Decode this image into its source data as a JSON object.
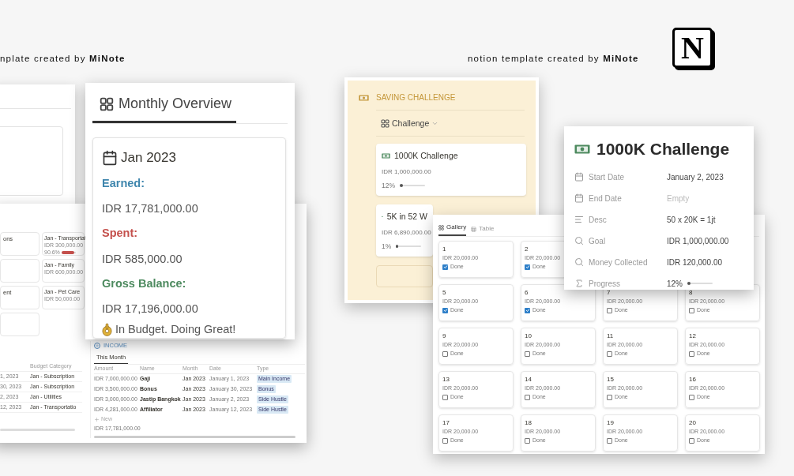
{
  "captions": [
    {
      "text": "nplate created by **MiNote**"
    },
    {
      "text": "notion template created by **MiNote**"
    }
  ],
  "logo": {
    "letter": "N"
  },
  "budget_cards": {
    "left": [
      {
        "kind": "titled",
        "title": "ons"
      },
      {
        "kind": "blank"
      },
      {
        "kind": "titled",
        "title": "ent"
      },
      {
        "kind": "blank"
      }
    ],
    "right": [
      {
        "title": "Jan - Transportat",
        "amount": "IDR 300,000.00",
        "percent": "90.6%",
        "level": 0.9
      },
      {
        "title": "Jan - Family",
        "amount": "IDR 600,000.00"
      },
      {
        "title": "Jan - Pet Care",
        "amount": "IDR 50,000.00"
      }
    ]
  },
  "expense_table": {
    "column": "Budget Category",
    "rows": [
      {
        "date": "1, 2023",
        "category": "Jan - Subscription"
      },
      {
        "date": "30, 2023",
        "category": "Jan - Subscription"
      },
      {
        "date": "2, 2023",
        "category": "Jan - Utilities"
      },
      {
        "date": "12, 2023",
        "category": "Jan - Transportatio"
      }
    ]
  },
  "income": {
    "title": "INCOME",
    "tab": "This Month",
    "columns": [
      "Amount",
      "Name",
      "Month",
      "Date",
      "Type"
    ],
    "rows": [
      {
        "amount": "IDR 7,000,000.00",
        "name": "Gaji",
        "month": "Jan 2023",
        "date": "January 1, 2023",
        "type": "Main Income"
      },
      {
        "amount": "IDR 3,500,000.00",
        "name": "Bonus",
        "month": "Jan 2023",
        "date": "January 30, 2023",
        "type": "Bonus"
      },
      {
        "amount": "IDR 3,000,000.00",
        "name": "Jastip Bangkok",
        "month": "Jan 2023",
        "date": "January 2, 2023",
        "type": "Side Hustle"
      },
      {
        "amount": "IDR 4,281,000.00",
        "name": "Affiliator",
        "month": "Jan 2023",
        "date": "January 12, 2023",
        "type": "Side Hustle"
      }
    ],
    "new": "New",
    "total": "IDR 17,781,000.00"
  },
  "monthly": {
    "title": "Monthly Overview",
    "month": "Jan 2023",
    "lines": [
      {
        "label": "Earned:",
        "value": "IDR 17,781,000.00",
        "color": "#3f86ad"
      },
      {
        "label": "Spent:",
        "value": "IDR 585,000.00",
        "color": "#c4504c"
      },
      {
        "label": "Gross Balance:",
        "value": "IDR 17,196,000.00",
        "color": "#4d8a5f"
      }
    ],
    "status": "In Budget. Doing Great!"
  },
  "saving": {
    "title": "SAVING CHALLENGE",
    "view": "Challenge",
    "cards": [
      {
        "title": "1000K Challenge",
        "amount": "IDR 1,000,000.00",
        "percent": "12%",
        "level": 0.12
      },
      {
        "title": "5K in 52 W",
        "amount": "IDR 6,890,000.00",
        "percent": "1%",
        "level": 0.01
      }
    ]
  },
  "gallery": {
    "tabs": [
      {
        "label": "Gallery",
        "selected": true
      },
      {
        "label": "Table",
        "selected": false
      }
    ],
    "rows": [
      [
        {
          "number": "1",
          "amount": "IDR 20,000.00",
          "label": "Done",
          "checked": true
        },
        {
          "number": "2",
          "amount": "IDR 20,000.00",
          "label": "Done",
          "checked": true
        }
      ],
      [
        {
          "number": "5",
          "amount": "IDR 20,000.00",
          "label": "Done",
          "checked": true
        },
        {
          "number": "6",
          "amount": "IDR 20,000.00",
          "label": "Done",
          "checked": true
        },
        {
          "number": "7",
          "amount": "IDR 20,000.00",
          "label": "Done",
          "checked": false
        },
        {
          "number": "8",
          "amount": "IDR 20,000.00",
          "label": "Done",
          "checked": false
        }
      ],
      [
        {
          "number": "9",
          "amount": "IDR 20,000.00",
          "label": "Done",
          "checked": false
        },
        {
          "number": "10",
          "amount": "IDR 20,000.00",
          "label": "Done",
          "checked": false
        },
        {
          "number": "11",
          "amount": "IDR 20,000.00",
          "label": "Done",
          "checked": false
        },
        {
          "number": "12",
          "amount": "IDR 20,000.00",
          "label": "Done",
          "checked": false
        }
      ],
      [
        {
          "number": "13",
          "amount": "IDR 20,000.00",
          "label": "Done",
          "checked": false
        },
        {
          "number": "14",
          "amount": "IDR 20,000.00",
          "label": "Done",
          "checked": false
        },
        {
          "number": "15",
          "amount": "IDR 20,000.00",
          "label": "Done",
          "checked": false
        },
        {
          "number": "16",
          "amount": "IDR 20,000.00",
          "label": "Done",
          "checked": false
        }
      ],
      [
        {
          "number": "17",
          "amount": "IDR 20,000.00",
          "label": "Done",
          "checked": false
        },
        {
          "number": "18",
          "amount": "IDR 20,000.00",
          "label": "Done",
          "checked": false
        },
        {
          "number": "19",
          "amount": "IDR 20,000.00",
          "label": "Done",
          "checked": false
        },
        {
          "number": "20",
          "amount": "IDR 20,000.00",
          "label": "Done",
          "checked": false
        }
      ]
    ]
  },
  "popup": {
    "title": "1000K Challenge",
    "properties": [
      {
        "kind": "date",
        "label": "Start Date",
        "value": "January 2, 2023",
        "empty": false
      },
      {
        "kind": "date",
        "label": "End Date",
        "value": "Empty",
        "empty": true
      },
      {
        "kind": "text",
        "label": "Desc",
        "value": "50 x 20K = 1jt",
        "empty": false
      },
      {
        "kind": "search",
        "label": "Goal",
        "value": "IDR 1,000,000.00",
        "empty": false
      },
      {
        "kind": "search",
        "label": "Money Collected",
        "value": "IDR 120,000.00",
        "empty": false
      },
      {
        "kind": "formula",
        "label": "Progress",
        "value": "12%",
        "empty": false,
        "level": 0.12
      }
    ]
  }
}
